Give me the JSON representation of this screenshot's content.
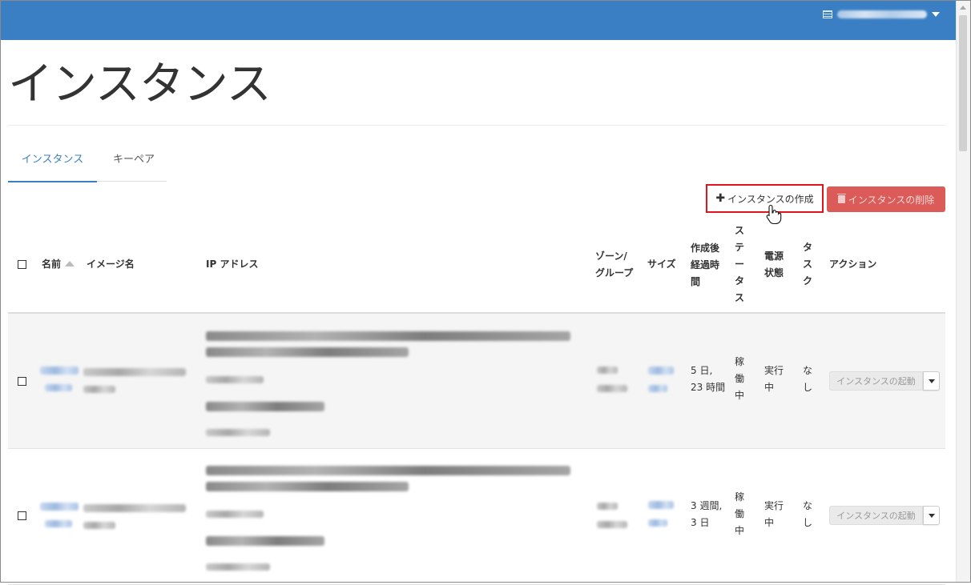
{
  "header": {
    "user_menu_label": "",
    "user_menu_icon": "document-icon"
  },
  "page": {
    "title": "インスタンス"
  },
  "tabs": [
    {
      "label": "インスタンス",
      "active": true
    },
    {
      "label": "キーペア",
      "active": false
    }
  ],
  "toolbar": {
    "create_label": "インスタンスの作成",
    "create_icon": "plus-icon",
    "delete_label": "インスタンスの削除",
    "delete_icon": "trash-icon"
  },
  "table": {
    "columns": {
      "name": "名前",
      "image": "イメージ名",
      "ip": "IP アドレス",
      "zone": "ゾーン/\nグループ",
      "size": "サイズ",
      "age": "作成後\n経過時\n間",
      "status": "ステータス",
      "power": "電源\n状態",
      "task": "タスク",
      "actions": "アクション"
    },
    "rows": [
      {
        "age": "5 日,\n23 時間",
        "status": "稼働中",
        "power": "実行\n中",
        "task": "なし",
        "action_label": "インスタンスの起動"
      },
      {
        "age": "3 週間,\n3 日",
        "status": "稼働中",
        "power": "実行\n中",
        "task": "なし",
        "action_label": "インスタンスの起動"
      }
    ]
  },
  "colors": {
    "topbar": "#3a7fc4",
    "accent": "#3a7fc4",
    "danger": "#d9534f",
    "highlight_box": "#e0141b"
  }
}
